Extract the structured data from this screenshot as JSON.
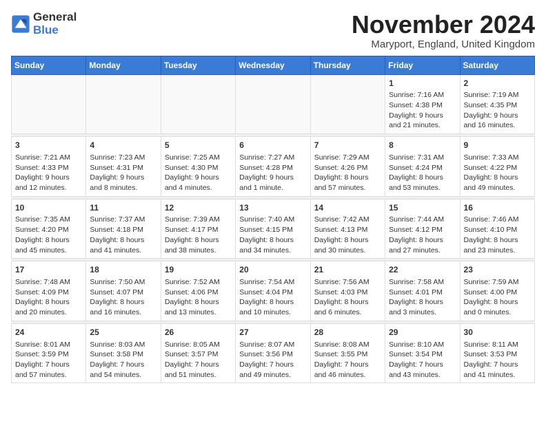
{
  "logo": {
    "general": "General",
    "blue": "Blue"
  },
  "title": "November 2024",
  "location": "Maryport, England, United Kingdom",
  "days": [
    "Sunday",
    "Monday",
    "Tuesday",
    "Wednesday",
    "Thursday",
    "Friday",
    "Saturday"
  ],
  "weeks": [
    [
      {
        "day": "",
        "info": ""
      },
      {
        "day": "",
        "info": ""
      },
      {
        "day": "",
        "info": ""
      },
      {
        "day": "",
        "info": ""
      },
      {
        "day": "",
        "info": ""
      },
      {
        "day": "1",
        "info": "Sunrise: 7:16 AM\nSunset: 4:38 PM\nDaylight: 9 hours and 21 minutes."
      },
      {
        "day": "2",
        "info": "Sunrise: 7:19 AM\nSunset: 4:35 PM\nDaylight: 9 hours and 16 minutes."
      }
    ],
    [
      {
        "day": "3",
        "info": "Sunrise: 7:21 AM\nSunset: 4:33 PM\nDaylight: 9 hours and 12 minutes."
      },
      {
        "day": "4",
        "info": "Sunrise: 7:23 AM\nSunset: 4:31 PM\nDaylight: 9 hours and 8 minutes."
      },
      {
        "day": "5",
        "info": "Sunrise: 7:25 AM\nSunset: 4:30 PM\nDaylight: 9 hours and 4 minutes."
      },
      {
        "day": "6",
        "info": "Sunrise: 7:27 AM\nSunset: 4:28 PM\nDaylight: 9 hours and 1 minute."
      },
      {
        "day": "7",
        "info": "Sunrise: 7:29 AM\nSunset: 4:26 PM\nDaylight: 8 hours and 57 minutes."
      },
      {
        "day": "8",
        "info": "Sunrise: 7:31 AM\nSunset: 4:24 PM\nDaylight: 8 hours and 53 minutes."
      },
      {
        "day": "9",
        "info": "Sunrise: 7:33 AM\nSunset: 4:22 PM\nDaylight: 8 hours and 49 minutes."
      }
    ],
    [
      {
        "day": "10",
        "info": "Sunrise: 7:35 AM\nSunset: 4:20 PM\nDaylight: 8 hours and 45 minutes."
      },
      {
        "day": "11",
        "info": "Sunrise: 7:37 AM\nSunset: 4:18 PM\nDaylight: 8 hours and 41 minutes."
      },
      {
        "day": "12",
        "info": "Sunrise: 7:39 AM\nSunset: 4:17 PM\nDaylight: 8 hours and 38 minutes."
      },
      {
        "day": "13",
        "info": "Sunrise: 7:40 AM\nSunset: 4:15 PM\nDaylight: 8 hours and 34 minutes."
      },
      {
        "day": "14",
        "info": "Sunrise: 7:42 AM\nSunset: 4:13 PM\nDaylight: 8 hours and 30 minutes."
      },
      {
        "day": "15",
        "info": "Sunrise: 7:44 AM\nSunset: 4:12 PM\nDaylight: 8 hours and 27 minutes."
      },
      {
        "day": "16",
        "info": "Sunrise: 7:46 AM\nSunset: 4:10 PM\nDaylight: 8 hours and 23 minutes."
      }
    ],
    [
      {
        "day": "17",
        "info": "Sunrise: 7:48 AM\nSunset: 4:09 PM\nDaylight: 8 hours and 20 minutes."
      },
      {
        "day": "18",
        "info": "Sunrise: 7:50 AM\nSunset: 4:07 PM\nDaylight: 8 hours and 16 minutes."
      },
      {
        "day": "19",
        "info": "Sunrise: 7:52 AM\nSunset: 4:06 PM\nDaylight: 8 hours and 13 minutes."
      },
      {
        "day": "20",
        "info": "Sunrise: 7:54 AM\nSunset: 4:04 PM\nDaylight: 8 hours and 10 minutes."
      },
      {
        "day": "21",
        "info": "Sunrise: 7:56 AM\nSunset: 4:03 PM\nDaylight: 8 hours and 6 minutes."
      },
      {
        "day": "22",
        "info": "Sunrise: 7:58 AM\nSunset: 4:01 PM\nDaylight: 8 hours and 3 minutes."
      },
      {
        "day": "23",
        "info": "Sunrise: 7:59 AM\nSunset: 4:00 PM\nDaylight: 8 hours and 0 minutes."
      }
    ],
    [
      {
        "day": "24",
        "info": "Sunrise: 8:01 AM\nSunset: 3:59 PM\nDaylight: 7 hours and 57 minutes."
      },
      {
        "day": "25",
        "info": "Sunrise: 8:03 AM\nSunset: 3:58 PM\nDaylight: 7 hours and 54 minutes."
      },
      {
        "day": "26",
        "info": "Sunrise: 8:05 AM\nSunset: 3:57 PM\nDaylight: 7 hours and 51 minutes."
      },
      {
        "day": "27",
        "info": "Sunrise: 8:07 AM\nSunset: 3:56 PM\nDaylight: 7 hours and 49 minutes."
      },
      {
        "day": "28",
        "info": "Sunrise: 8:08 AM\nSunset: 3:55 PM\nDaylight: 7 hours and 46 minutes."
      },
      {
        "day": "29",
        "info": "Sunrise: 8:10 AM\nSunset: 3:54 PM\nDaylight: 7 hours and 43 minutes."
      },
      {
        "day": "30",
        "info": "Sunrise: 8:11 AM\nSunset: 3:53 PM\nDaylight: 7 hours and 41 minutes."
      }
    ]
  ]
}
